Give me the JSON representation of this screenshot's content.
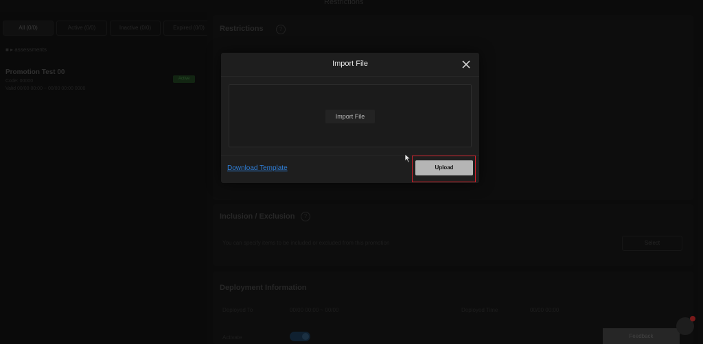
{
  "window": {
    "title": "Restrictions"
  },
  "left_panel": {
    "tabs": [
      "All (0/0)",
      "Active (0/0)",
      "Inactive (0/0)",
      "Expired (0/0)"
    ],
    "filter_label": "■ ▸ assessments",
    "item": {
      "name": "Promotion Test 00",
      "line1": "Code: 00000",
      "line2": "Valid 00/00 00:00 ~ 00/00 00:00 0000",
      "badge": "Active"
    }
  },
  "main": {
    "restrictions": {
      "title": "Restrictions"
    },
    "inclusion": {
      "title": "Inclusion / Exclusion",
      "desc": "You can specify items to be included or excluded from this promotion",
      "button": "Select"
    },
    "deployment": {
      "title": "Deployment Information",
      "field1_label": "Deployed To",
      "field1_value": "00/00 00:00 ~ 00/00",
      "field2_label": "Deployed Time",
      "field2_value": "00/00 00:00",
      "status_label": "Activate"
    }
  },
  "modal": {
    "title": "Import File",
    "import_button": "Import File",
    "download_link": "Download Template",
    "upload_button": "Upload"
  },
  "toast": {
    "text": "Feedback"
  },
  "icons": {
    "close": "close-icon",
    "cursor": "mouse-pointer-icon",
    "help": "help-circle-icon"
  },
  "colors": {
    "link": "#2f7fd9",
    "highlight": "#d0202a",
    "upload_bg": "#b5b5b5"
  }
}
